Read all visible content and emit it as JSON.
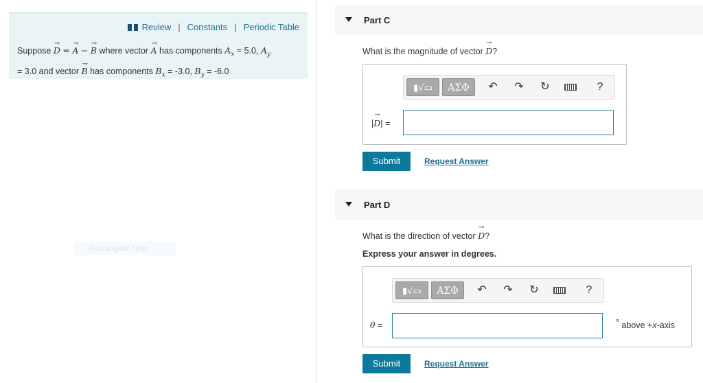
{
  "nav": {
    "review": "Review",
    "sep": "|",
    "constants": "Constants",
    "periodic_table": "Periodic Table"
  },
  "problem": {
    "w1": "Suppose",
    "D": "D",
    "eq": "=",
    "A": "A",
    "minus": "−",
    "B": "B",
    "w2": "where vector",
    "w3": "has components",
    "Ax_base": "A",
    "x": "x",
    "Ax_val": "= 5.0,",
    "Ay_base": "A",
    "y": "y",
    "Ay_val": "= 3.0 and vector",
    "w4": "has components",
    "Bx_base": "B",
    "Bx_val": "= -3.0,",
    "By_base": "B",
    "By_val": "= -6.0"
  },
  "faded_tool_label": "Rectangular Snip",
  "partC": {
    "title": "Part C",
    "question_pre": "What is the magnitude of vector",
    "question_var": "D",
    "question_post": "?",
    "input_label_pre": "|",
    "input_label_var": "D",
    "input_label_post": "| =",
    "input_value": "",
    "submit": "Submit",
    "request": "Request Answer"
  },
  "partD": {
    "title": "Part D",
    "question_pre": "What is the direction of vector",
    "question_var": "D",
    "question_post": "?",
    "hint": "Express your answer in degrees.",
    "input_label_var": "θ",
    "input_label_post": " =",
    "input_value": "",
    "unit_deg": "°",
    "unit_pre": "above +",
    "unit_var": "x",
    "unit_post": "-axis",
    "submit": "Submit",
    "request": "Request Answer"
  },
  "toolbar": {
    "templates_icon": "templates-icon",
    "greek": "ΑΣΦ",
    "undo": "↶",
    "redo": "↷",
    "reset": "↻",
    "help": "?"
  },
  "colors": {
    "accent": "#0c7a9b",
    "link": "#1a6f93",
    "info_bg": "#e8f4f6"
  }
}
